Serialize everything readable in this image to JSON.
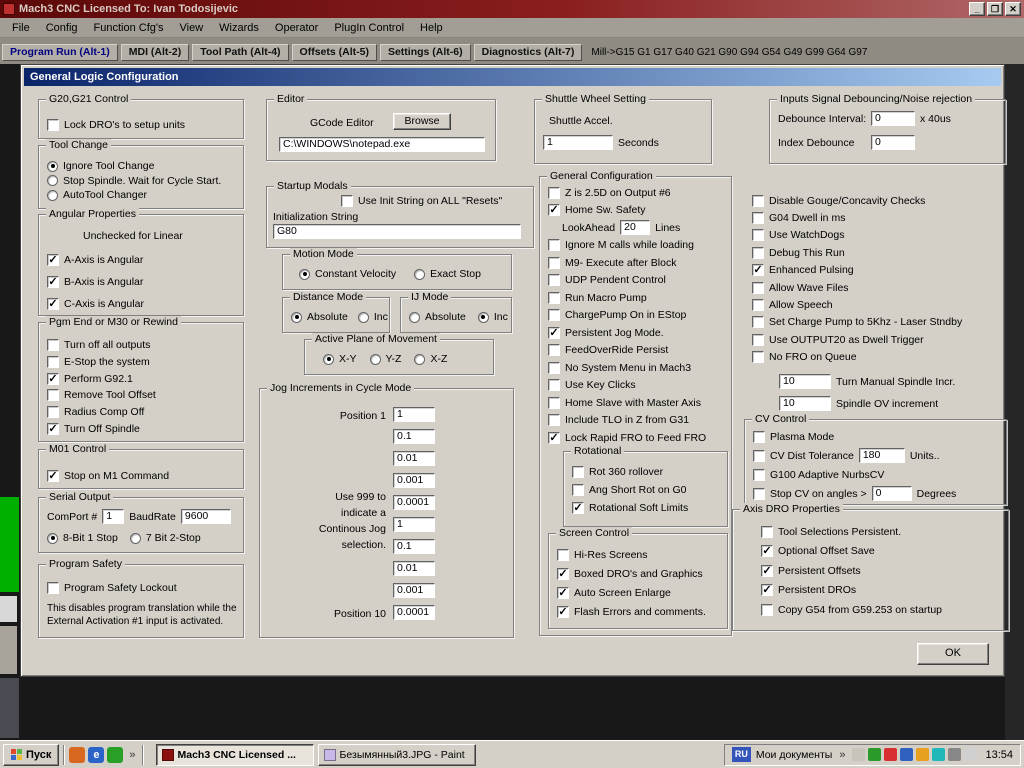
{
  "colors": {
    "chrome": "#d4d0c8",
    "window_titlebar": "#5c0808",
    "dialog_title_start": "#0a246a",
    "dialog_title_end": "#a6caf0",
    "desktop": "#181818",
    "accent_green": "#00b800"
  },
  "window": {
    "title": "Mach3 CNC  Licensed To: Ivan Todosijevic",
    "controls": {
      "minimize": "_",
      "maximize": "❐",
      "close": "✕"
    },
    "menu": [
      {
        "label": "File",
        "name": "menu-file"
      },
      {
        "label": "Config",
        "name": "menu-config"
      },
      {
        "label": "Function Cfg's",
        "name": "menu-function-cfgs"
      },
      {
        "label": "View",
        "name": "menu-view"
      },
      {
        "label": "Wizards",
        "name": "menu-wizards"
      },
      {
        "label": "Operator",
        "name": "menu-operator"
      },
      {
        "label": "PlugIn Control",
        "name": "menu-plugin-control"
      },
      {
        "label": "Help",
        "name": "menu-help"
      }
    ],
    "tabs": [
      {
        "label": "Program Run (Alt-1)",
        "name": "tab-program-run",
        "active": true
      },
      {
        "label": "MDI (Alt-2)",
        "name": "tab-mdi"
      },
      {
        "label": "Tool Path (Alt-4)",
        "name": "tab-tool-path"
      },
      {
        "label": "Offsets (Alt-5)",
        "name": "tab-offsets"
      },
      {
        "label": "Settings (Alt-6)",
        "name": "tab-settings"
      },
      {
        "label": "Diagnostics (Alt-7)",
        "name": "tab-diagnostics"
      }
    ],
    "mode_status": "Mill->G15 G1 G17 G40 G21 G90 G94 G54 G49 G99 G64 G97"
  },
  "dialog": {
    "title": "General Logic Configuration",
    "ok_label": "OK",
    "g20_control": {
      "title": "G20,G21 Control",
      "items": [
        {
          "label": "Lock DRO's to setup units",
          "checked": false
        }
      ]
    },
    "tool_change": {
      "title": "Tool Change",
      "items": [
        {
          "label": "Ignore Tool Change",
          "selected": true
        },
        {
          "label": "Stop Spindle. Wait for Cycle Start.",
          "selected": false
        },
        {
          "label": "AutoTool Changer",
          "selected": false
        }
      ]
    },
    "angular": {
      "title": "Angular Properties",
      "note": "Unchecked for Linear",
      "items": [
        {
          "label": "A-Axis is Angular",
          "checked": true
        },
        {
          "label": "B-Axis is Angular",
          "checked": true
        },
        {
          "label": "C-Axis is Angular",
          "checked": true
        }
      ]
    },
    "pgm_end": {
      "title": "Pgm End or M30 or Rewind",
      "items": [
        {
          "label": "Turn off all outputs",
          "checked": false
        },
        {
          "label": "E-Stop the system",
          "checked": false
        },
        {
          "label": "Perform G92.1",
          "checked": true
        },
        {
          "label": "Remove Tool Offset",
          "checked": false
        },
        {
          "label": "Radius Comp Off",
          "checked": false
        },
        {
          "label": "Turn Off Spindle",
          "checked": true
        }
      ]
    },
    "m01": {
      "title": "M01 Control",
      "items": [
        {
          "label": "Stop on M1 Command",
          "checked": true
        }
      ]
    },
    "serial": {
      "title": "Serial Output",
      "comport_label": "ComPort #",
      "comport_value": "1",
      "baud_label": "BaudRate",
      "baud_value": "9600",
      "items": [
        {
          "label": "8-Bit 1 Stop",
          "selected": true
        },
        {
          "label": "7 Bit 2-Stop",
          "selected": false
        }
      ]
    },
    "program_safety": {
      "title": "Program Safety",
      "items": [
        {
          "label": "Program Safety Lockout",
          "checked": false
        }
      ],
      "note_lines": [
        "This disables program translation while the",
        "External Activation #1 input is activated."
      ]
    },
    "editor": {
      "title": "Editor",
      "label": "GCode Editor",
      "browse": "Browse",
      "path": "C:\\WINDOWS\\notepad.exe"
    },
    "startup_modals": {
      "title": "Startup Modals",
      "items": [
        {
          "label": "Use Init String on ALL  \"Resets\"",
          "checked": false
        }
      ],
      "init_label": "Initialization String",
      "init_value": "G80"
    },
    "motion_mode": {
      "title": "Motion Mode",
      "items": [
        {
          "label": "Constant Velocity",
          "selected": true
        },
        {
          "label": "Exact Stop",
          "selected": false
        }
      ]
    },
    "distance_mode": {
      "title": "Distance Mode",
      "items": [
        {
          "label": "Absolute",
          "selected": true
        },
        {
          "label": "Inc",
          "selected": false
        }
      ]
    },
    "ij_mode": {
      "title": "IJ Mode",
      "items": [
        {
          "label": "Absolute",
          "selected": false
        },
        {
          "label": "Inc",
          "selected": true
        }
      ]
    },
    "active_plane": {
      "title": "Active Plane of Movement",
      "items": [
        {
          "label": "X-Y",
          "selected": true
        },
        {
          "label": "Y-Z",
          "selected": false
        },
        {
          "label": "X-Z",
          "selected": false
        }
      ]
    },
    "jog": {
      "title": "Jog Increments in Cycle Mode",
      "pos1_label": "Position 1",
      "pos10_label": "Position 10",
      "note_lines": [
        "Use 999 to",
        "indicate a",
        "Continous Jog",
        "selection."
      ],
      "values": [
        "1",
        "0.1",
        "0.01",
        "0.001",
        "0.0001",
        "1",
        "0.1",
        "0.01",
        "0.001",
        "0.0001"
      ]
    },
    "shuttle": {
      "title": "Shuttle Wheel Setting",
      "accel_label": "Shuttle Accel.",
      "accel_value": "1",
      "unit": "Seconds"
    },
    "general_config": {
      "title": "General Configuration",
      "items": [
        {
          "label": "Z is 2.5D on Output #6",
          "checked": false
        },
        {
          "label": "Home Sw. Safety",
          "checked": true
        },
        {
          "type": "field",
          "label": "LookAhead",
          "value": "20",
          "w": 30,
          "unit": "Lines"
        },
        {
          "label": "Ignore M calls while loading",
          "checked": false
        },
        {
          "label": "M9- Execute after Block",
          "checked": false
        },
        {
          "label": "UDP Pendent Control",
          "checked": false
        },
        {
          "label": "Run Macro Pump",
          "checked": false
        },
        {
          "label": "ChargePump On in EStop",
          "checked": false
        },
        {
          "label": "Persistent Jog Mode.",
          "checked": true
        },
        {
          "label": "FeedOverRide Persist",
          "checked": false
        },
        {
          "label": "No System Menu in Mach3",
          "checked": false
        },
        {
          "label": "Use Key Clicks",
          "checked": false
        },
        {
          "label": "Home Slave with Master Axis",
          "checked": false
        },
        {
          "label": "Include TLO in Z from G31",
          "checked": false
        },
        {
          "label": "Lock Rapid FRO to Feed FRO",
          "checked": true
        }
      ],
      "rotational": {
        "title": "Rotational",
        "items": [
          {
            "label": "Rot 360 rollover",
            "checked": false
          },
          {
            "label": "Ang Short Rot on G0",
            "checked": false
          },
          {
            "label": "Rotational Soft Limits",
            "checked": true
          }
        ]
      },
      "screen_control": {
        "title": "Screen Control",
        "items": [
          {
            "label": "Hi-Res Screens",
            "checked": false
          },
          {
            "label": "Boxed DRO's and Graphics",
            "checked": true
          },
          {
            "label": "Auto Screen Enlarge",
            "checked": true
          },
          {
            "label": "Flash Errors and comments.",
            "checked": true
          }
        ]
      }
    },
    "general_right": {
      "items": [
        {
          "label": "Disable Gouge/Concavity Checks",
          "checked": false
        },
        {
          "label": "G04 Dwell in ms",
          "checked": false
        },
        {
          "label": "Use WatchDogs",
          "checked": false
        },
        {
          "label": "Debug This Run",
          "checked": false
        },
        {
          "label": "Enhanced Pulsing",
          "checked": true
        },
        {
          "label": "Allow Wave Files",
          "checked": false
        },
        {
          "label": "Allow Speech",
          "checked": false
        },
        {
          "label": "Set Charge Pump to 5Khz - Laser Stndby",
          "checked": false
        },
        {
          "label": "Use OUTPUT20 as Dwell Trigger",
          "checked": false
        },
        {
          "label": "No FRO on Queue",
          "checked": false
        }
      ],
      "spindle_incr_value": "10",
      "spindle_incr_label": "Turn Manual Spindle Incr.",
      "spindle_ov_value": "10",
      "spindle_ov_label": "Spindle OV increment"
    },
    "debounce": {
      "title": "Inputs Signal Debouncing/Noise rejection",
      "interval_label": "Debounce Interval:",
      "interval_value": "0",
      "interval_unit": "x 40us",
      "index_label": "Index Debounce",
      "index_value": "0"
    },
    "cv_control": {
      "title": "CV Control",
      "items": [
        {
          "label": "Plasma Mode",
          "checked": false
        },
        {
          "label": "CV Dist Tolerance",
          "checked": false,
          "value": "180",
          "w": 46,
          "unit": "Units.."
        },
        {
          "label": "G100 Adaptive NurbsCV",
          "checked": false
        },
        {
          "label": "Stop CV on angles >",
          "checked": false,
          "value": "0",
          "w": 40,
          "unit": "Degrees"
        }
      ]
    },
    "axis_dro": {
      "title": "Axis DRO Properties",
      "items": [
        {
          "label": "Tool Selections Persistent.",
          "checked": false
        },
        {
          "label": "Optional Offset Save",
          "checked": true
        },
        {
          "label": "Persistent Offsets",
          "checked": true
        },
        {
          "label": "Persistent DROs",
          "checked": true
        },
        {
          "label": "Copy G54 from G59.253 on startup",
          "checked": false
        }
      ]
    }
  },
  "taskbar": {
    "start": "Пуск",
    "chevron": "»",
    "quick_launch": [
      {
        "name": "launch-icon-1",
        "label": "",
        "color": "#d86820"
      },
      {
        "name": "ie-icon",
        "label": "e",
        "color": "#2a62c8"
      },
      {
        "name": "launch-icon-2",
        "label": "",
        "color": "#28a028"
      }
    ],
    "tasks": [
      {
        "label": "Mach3 CNC  Licensed ...",
        "active": true,
        "icon_color": "#8b1010"
      },
      {
        "label": "Безымянный3.JPG - Paint",
        "active": false,
        "icon_color": "#c8b8e8"
      }
    ],
    "tray": {
      "lang": "RU",
      "docs_label": "Мои документы",
      "icons": [
        {
          "name": "tray-icon",
          "label": "",
          "color": "#c8c4bc"
        },
        {
          "name": "tray-icon",
          "label": "",
          "color": "#2a9a2a"
        },
        {
          "name": "tray-icon",
          "label": "",
          "color": "#d83030"
        },
        {
          "name": "tray-icon",
          "label": "",
          "color": "#3060c0"
        },
        {
          "name": "tray-icon",
          "label": "",
          "color": "#e8a020"
        },
        {
          "name": "tray-icon",
          "label": "",
          "color": "#20b8b8"
        },
        {
          "name": "tray-icon",
          "label": "",
          "color": "#888888"
        },
        {
          "name": "tray-icon",
          "label": "",
          "color": "#d0d0d0"
        }
      ],
      "time": "13:54"
    }
  }
}
